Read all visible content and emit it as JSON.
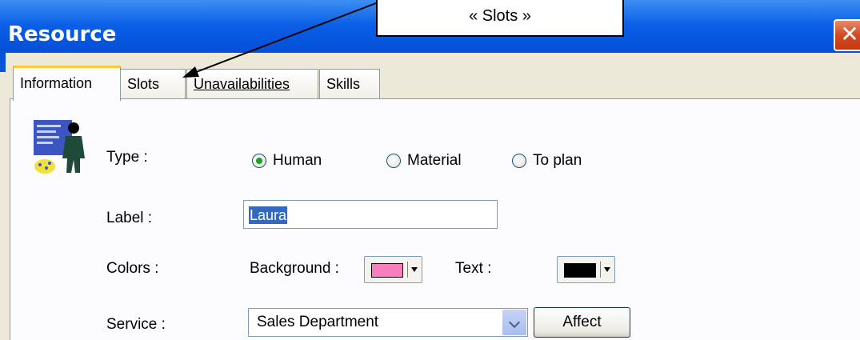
{
  "window": {
    "title": "Resource",
    "close_label": "✕"
  },
  "callout": {
    "text": "« Slots »"
  },
  "tabs": [
    {
      "label": "Information",
      "active": true
    },
    {
      "label": "Slots",
      "active": false
    },
    {
      "label": "Unavailabilities",
      "active": false
    },
    {
      "label": "Skills",
      "active": false
    }
  ],
  "form": {
    "type_label": "Type :",
    "type_options": [
      {
        "label": "Human",
        "checked": true
      },
      {
        "label": "Material",
        "checked": false
      },
      {
        "label": "To plan",
        "checked": false
      }
    ],
    "label_label": "Label :",
    "label_value": "Laura",
    "colors_label": "Colors :",
    "background_label": "Background :",
    "background_color": "#f77fbe",
    "text_label": "Text :",
    "text_color": "#000000",
    "service_label": "Service :",
    "service_value": "Sales Department",
    "affect_label": "Affect"
  },
  "icons": {
    "resource": "person-resource-icon"
  }
}
